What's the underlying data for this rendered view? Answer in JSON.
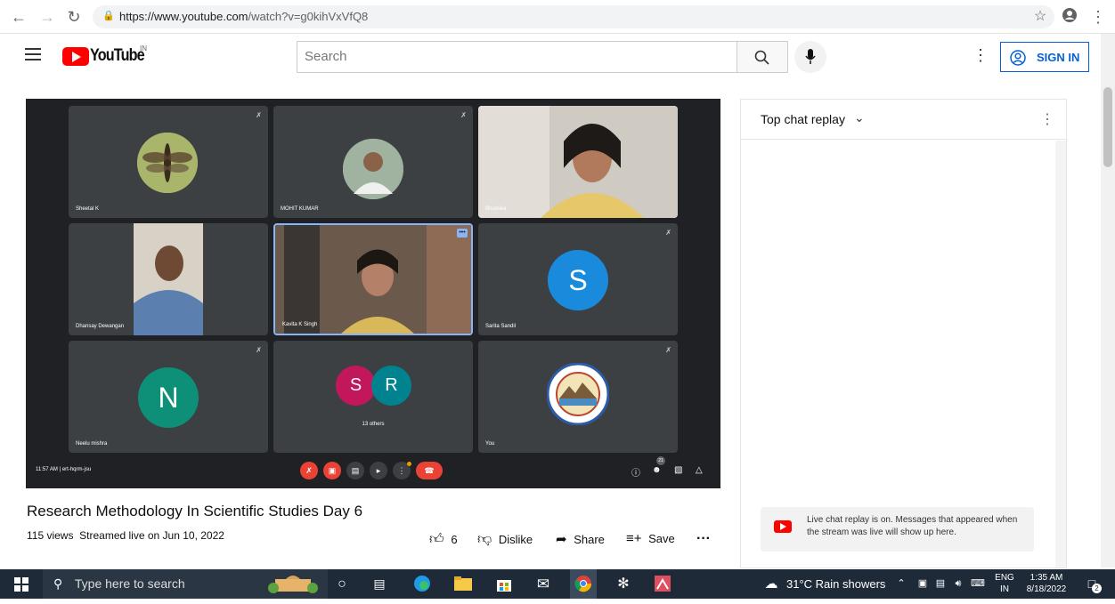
{
  "browser": {
    "url_host": "https://www.youtube.com",
    "url_path": "/watch?v=g0kihVxVfQ8"
  },
  "header": {
    "logo_text": "YouTube",
    "region": "IN",
    "search_placeholder": "Search",
    "sign_in_label": "SIGN IN"
  },
  "video": {
    "participants": [
      {
        "name": "Sheetal K"
      },
      {
        "name": "MOHIT KUMAR"
      },
      {
        "name": "Bhumika"
      },
      {
        "name": "Dhansay Dewangan"
      },
      {
        "name": "Kavita K Singh"
      },
      {
        "name": "Sarita Sandil",
        "initial": "S"
      },
      {
        "name": "Neelu mishra",
        "initial": "N"
      },
      {
        "name": "13 others",
        "initials": [
          "S",
          "R"
        ]
      },
      {
        "name": "You"
      }
    ],
    "meeting_time": "11:57 AM",
    "meeting_code": "ert-hqrm-jsu",
    "people_count": "21",
    "title": "Research Methodology In Scientific Studies Day 6",
    "views": "115 views",
    "streamed": "Streamed live on Jun 10, 2022",
    "likes": "6",
    "dislike_label": "Dislike",
    "share_label": "Share",
    "save_label": "Save"
  },
  "chat": {
    "header": "Top chat replay",
    "notice": "Live chat replay is on. Messages that appeared when the stream was live will show up here."
  },
  "taskbar": {
    "search_placeholder": "Type here to search",
    "weather": "31°C  Rain showers",
    "lang_top": "ENG",
    "lang_bottom": "IN",
    "time": "1:35 AM",
    "date": "8/18/2022",
    "notif_count": "2"
  }
}
